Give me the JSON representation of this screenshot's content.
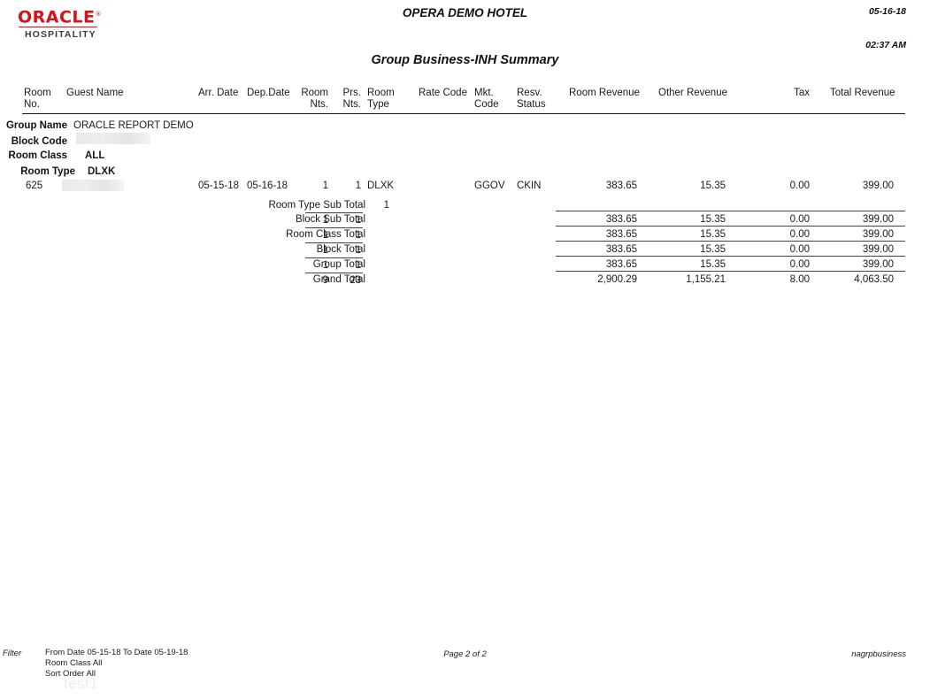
{
  "brand": {
    "name": "ORACLE",
    "registered": "®",
    "sub": "HOSPITALITY",
    "color": "#d6121a"
  },
  "header": {
    "hotel_name": "OPERA DEMO HOTEL",
    "date": "05-16-18",
    "time": "02:37 AM",
    "report_title": "Group Business-INH Summary"
  },
  "columns": {
    "room_no_l1": "Room",
    "room_no_l2": "No.",
    "guest_name": "Guest Name",
    "arr_date": "Arr. Date",
    "dep_date": "Dep.Date",
    "room_nts_l1": "Room",
    "room_nts_l2": "Nts.",
    "prs_nts_l1": "Prs.",
    "prs_nts_l2": "Nts.",
    "room_type_l1": "Room",
    "room_type_l2": "Type",
    "rate_code": "Rate Code",
    "mkt_code_l1": "Mkt.",
    "mkt_code_l2": "Code",
    "resv_status_l1": "Resv.",
    "resv_status_l2": "Status",
    "room_revenue": "Room Revenue",
    "other_revenue": "Other Revenue",
    "tax": "Tax",
    "total_revenue": "Total Revenue"
  },
  "group_info": [
    {
      "label": "Group Name",
      "value": "ORACLE REPORT DEMO",
      "bold": false,
      "redacted": false
    },
    {
      "label": "Block Code",
      "value": "",
      "bold": false,
      "redacted": true
    },
    {
      "label": "Room Class",
      "value": "ALL",
      "bold": true,
      "redacted": false
    },
    {
      "label": "Room Type",
      "value": "DLXK",
      "bold": true,
      "redacted": false
    }
  ],
  "detail_rows": [
    {
      "room_no": "625",
      "guest_name": "",
      "guest_redacted": true,
      "arr_date": "05-15-18",
      "dep_date": "05-16-18",
      "room_nts": "1",
      "prs_nts": "1",
      "room_type": "DLXK",
      "rate_code": "",
      "mkt_code": "GGOV",
      "resv_status": "CKIN",
      "room_revenue": "383.65",
      "other_revenue": "15.35",
      "tax": "0.00",
      "total_revenue": "399.00"
    }
  ],
  "room_type_sub_total": {
    "label": "Room Type Sub Total",
    "prs_nts": "1"
  },
  "totals": [
    {
      "label": "Block Sub Total",
      "room_nts": "1",
      "prs_nts": "1",
      "room_revenue": "383.65",
      "other_revenue": "15.35",
      "tax": "0.00",
      "total_revenue": "399.00"
    },
    {
      "label": "Room Class Total",
      "room_nts": "1",
      "prs_nts": "1",
      "room_revenue": "383.65",
      "other_revenue": "15.35",
      "tax": "0.00",
      "total_revenue": "399.00"
    },
    {
      "label": "Block Total",
      "room_nts": "1",
      "prs_nts": "1",
      "room_revenue": "383.65",
      "other_revenue": "15.35",
      "tax": "0.00",
      "total_revenue": "399.00"
    },
    {
      "label": "Group Total",
      "room_nts": "1",
      "prs_nts": "1",
      "room_revenue": "383.65",
      "other_revenue": "15.35",
      "tax": "0.00",
      "total_revenue": "399.00"
    },
    {
      "label": "Grand Total",
      "room_nts": "9",
      "prs_nts": "23",
      "room_revenue": "2,900.29",
      "other_revenue": "1,155.21",
      "tax": "8.00",
      "total_revenue": "4,063.50"
    }
  ],
  "footer": {
    "filter_label": "Filter",
    "filter_line1": "From Date 05-15-18   To Date 05-19-18",
    "filter_line2": "Room Class All",
    "filter_line3": "Sort Order All",
    "page_label": "Page 2 of 2",
    "report_id": "nagrpbusiness",
    "watermark": "test1"
  }
}
